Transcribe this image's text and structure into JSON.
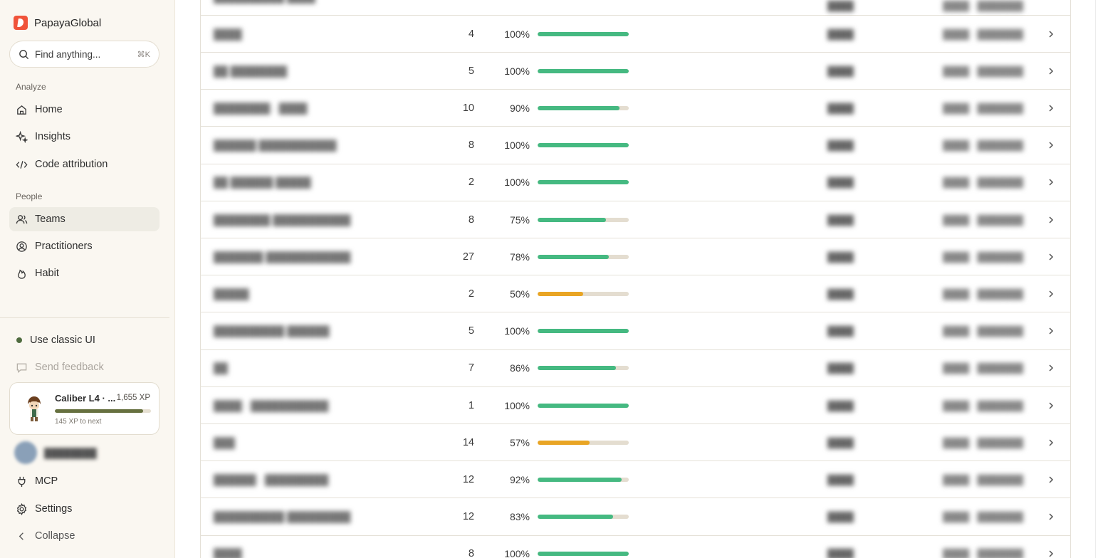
{
  "brand": {
    "name": "PapayaGlobal"
  },
  "search": {
    "placeholder": "Find anything...",
    "shortcut": "⌘K"
  },
  "sidebar": {
    "analyze_label": "Analyze",
    "people_label": "People",
    "nav": [
      {
        "label": "Home",
        "icon": "home-icon"
      },
      {
        "label": "Insights",
        "icon": "sparkle-icon"
      },
      {
        "label": "Code attribution",
        "icon": "code-icon"
      },
      {
        "label": "Teams",
        "icon": "users-icon",
        "active": true
      },
      {
        "label": "Practitioners",
        "icon": "user-circle-icon"
      },
      {
        "label": "Habit",
        "icon": "flame-icon"
      }
    ],
    "classic_ui": "Use classic UI",
    "feedback": "Send feedback",
    "mcp": "MCP",
    "settings": "Settings",
    "collapse": "Collapse"
  },
  "xp": {
    "title": "Caliber L4 · ...",
    "points": "1,655 XP",
    "next": "145 XP to next",
    "progress": 0.92
  },
  "colors": {
    "green": "#45b981",
    "orange": "#e9a524",
    "track": "#e4ddd0",
    "accent_dot": "#4f6b3f"
  },
  "rows": [
    {
      "count": "4",
      "pct": "100%",
      "value": 1.0,
      "color": "green"
    },
    {
      "count": "5",
      "pct": "100%",
      "value": 1.0,
      "color": "green"
    },
    {
      "count": "10",
      "pct": "90%",
      "value": 0.9,
      "color": "green"
    },
    {
      "count": "8",
      "pct": "100%",
      "value": 1.0,
      "color": "green"
    },
    {
      "count": "2",
      "pct": "100%",
      "value": 1.0,
      "color": "green"
    },
    {
      "count": "8",
      "pct": "75%",
      "value": 0.75,
      "color": "green"
    },
    {
      "count": "27",
      "pct": "78%",
      "value": 0.78,
      "color": "green"
    },
    {
      "count": "2",
      "pct": "50%",
      "value": 0.5,
      "color": "orange"
    },
    {
      "count": "5",
      "pct": "100%",
      "value": 1.0,
      "color": "green"
    },
    {
      "count": "7",
      "pct": "86%",
      "value": 0.86,
      "color": "green"
    },
    {
      "count": "1",
      "pct": "100%",
      "value": 1.0,
      "color": "green"
    },
    {
      "count": "14",
      "pct": "57%",
      "value": 0.57,
      "color": "orange"
    },
    {
      "count": "12",
      "pct": "92%",
      "value": 0.92,
      "color": "green"
    },
    {
      "count": "12",
      "pct": "83%",
      "value": 0.83,
      "color": "green"
    },
    {
      "count": "8",
      "pct": "100%",
      "value": 1.0,
      "color": "green"
    }
  ]
}
